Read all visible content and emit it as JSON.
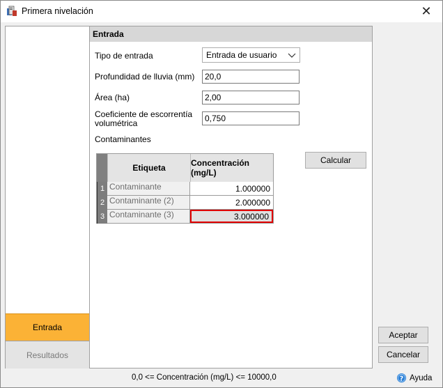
{
  "window": {
    "title": "Primera nivelación",
    "close_glyph": "✕"
  },
  "nav": {
    "entrada": "Entrada",
    "resultados": "Resultados"
  },
  "section": {
    "title": "Entrada"
  },
  "form": {
    "tipo_label": "Tipo de entrada",
    "tipo_value": "Entrada de usuario",
    "profundidad_label": "Profundidad de lluvia (mm)",
    "profundidad_value": "20,0",
    "area_label": "Área (ha)",
    "area_value": "2,00",
    "coef_label_1": "Coeficiente de escorrentía",
    "coef_label_2": "volumétrica",
    "coef_value": "0,750",
    "contaminantes_label": "Contaminantes"
  },
  "grid": {
    "headers": [
      "Etiqueta",
      "Concentración (mg/L)"
    ],
    "rows": [
      {
        "num": "1",
        "label": "Contaminante",
        "value": "1.000000"
      },
      {
        "num": "2",
        "label": "Contaminante (2)",
        "value": "2.000000"
      },
      {
        "num": "3",
        "label": "Contaminante (3)",
        "value": "3.000000"
      }
    ]
  },
  "buttons": {
    "calcular": "Calcular",
    "aceptar": "Aceptar",
    "cancelar": "Cancelar"
  },
  "status": "0,0 <= Concentración (mg/L) <= 10000,0",
  "help": {
    "label": "Ayuda",
    "icon": "help-circle-icon"
  },
  "colors": {
    "active_nav": "#fbb236",
    "selection_border": "#e00000",
    "help_icon": "#2a7fd6"
  }
}
